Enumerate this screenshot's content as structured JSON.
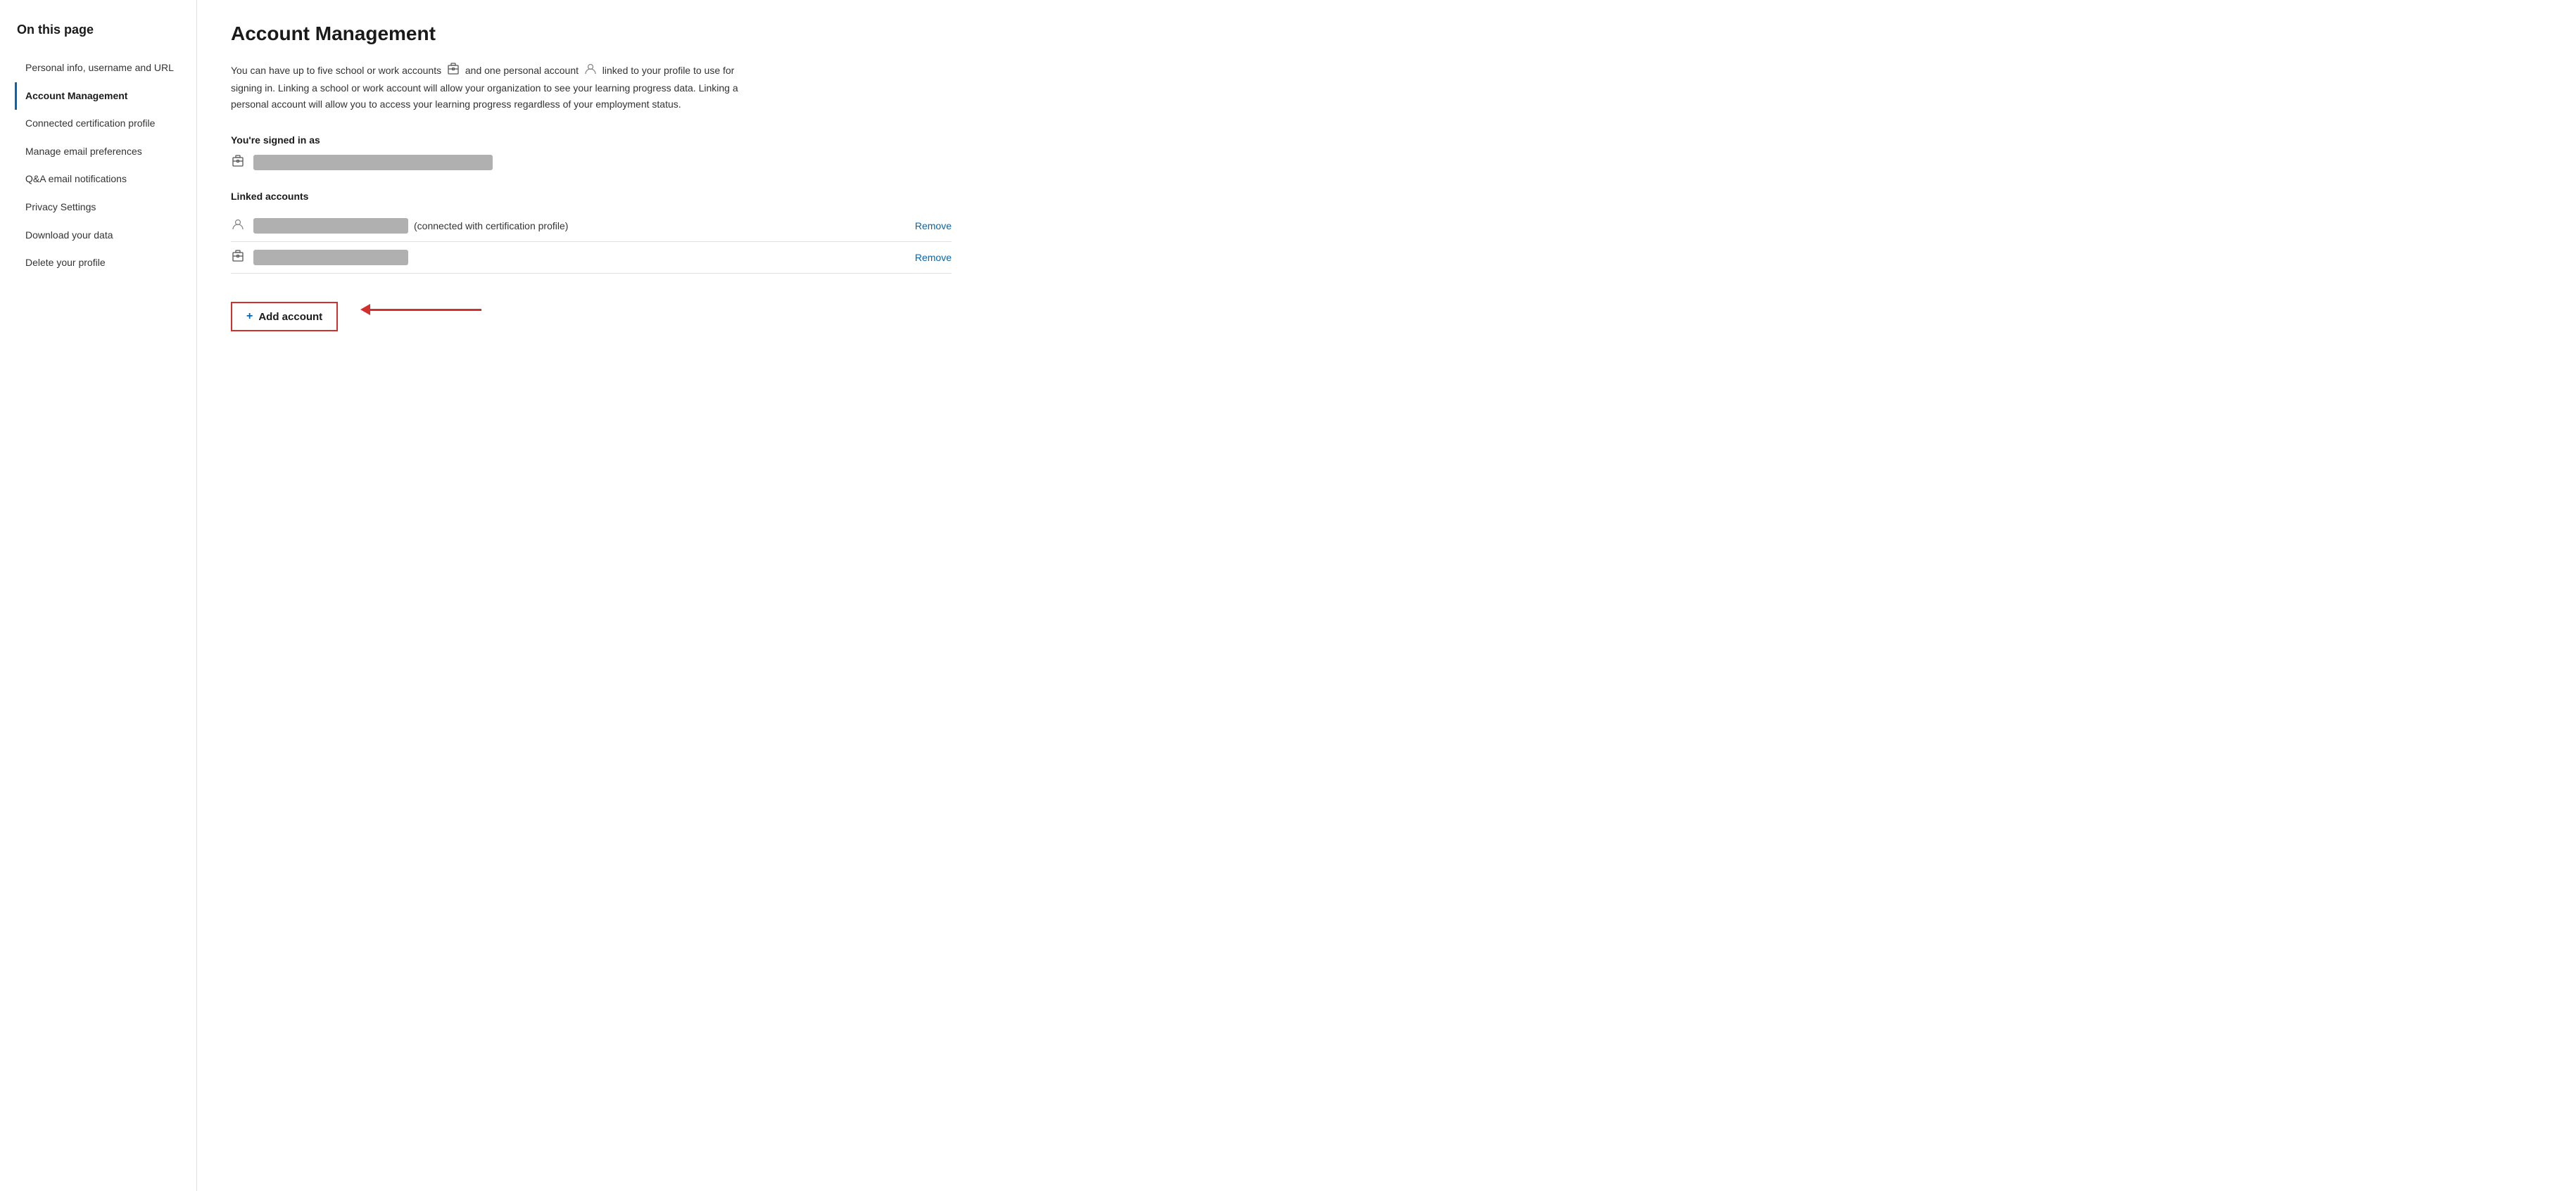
{
  "sidebar": {
    "heading": "On this page",
    "items": [
      {
        "id": "personal-info",
        "label": "Personal info, username and URL",
        "active": false
      },
      {
        "id": "account-management",
        "label": "Account Management",
        "active": true
      },
      {
        "id": "certification-profile",
        "label": "Connected certification profile",
        "active": false
      },
      {
        "id": "email-preferences",
        "label": "Manage email preferences",
        "active": false
      },
      {
        "id": "qa-notifications",
        "label": "Q&A email notifications",
        "active": false
      },
      {
        "id": "privacy-settings",
        "label": "Privacy Settings",
        "active": false
      },
      {
        "id": "download-data",
        "label": "Download your data",
        "active": false
      },
      {
        "id": "delete-profile",
        "label": "Delete your profile",
        "active": false
      }
    ]
  },
  "main": {
    "title": "Account Management",
    "description_part1": "You can have up to five school or work accounts",
    "description_part2": "and one personal account",
    "description_part3": "linked to your profile to use for signing in. Linking a school or work account will allow your organization to see your learning progress data. Linking a personal account will allow you to access your learning progress regardless of your employment status.",
    "signed_in_label": "You're signed in as",
    "linked_accounts_label": "Linked accounts",
    "linked_account1_suffix": "(connected with certification profile)",
    "remove_label": "Remove",
    "add_account_label": "Add account"
  }
}
